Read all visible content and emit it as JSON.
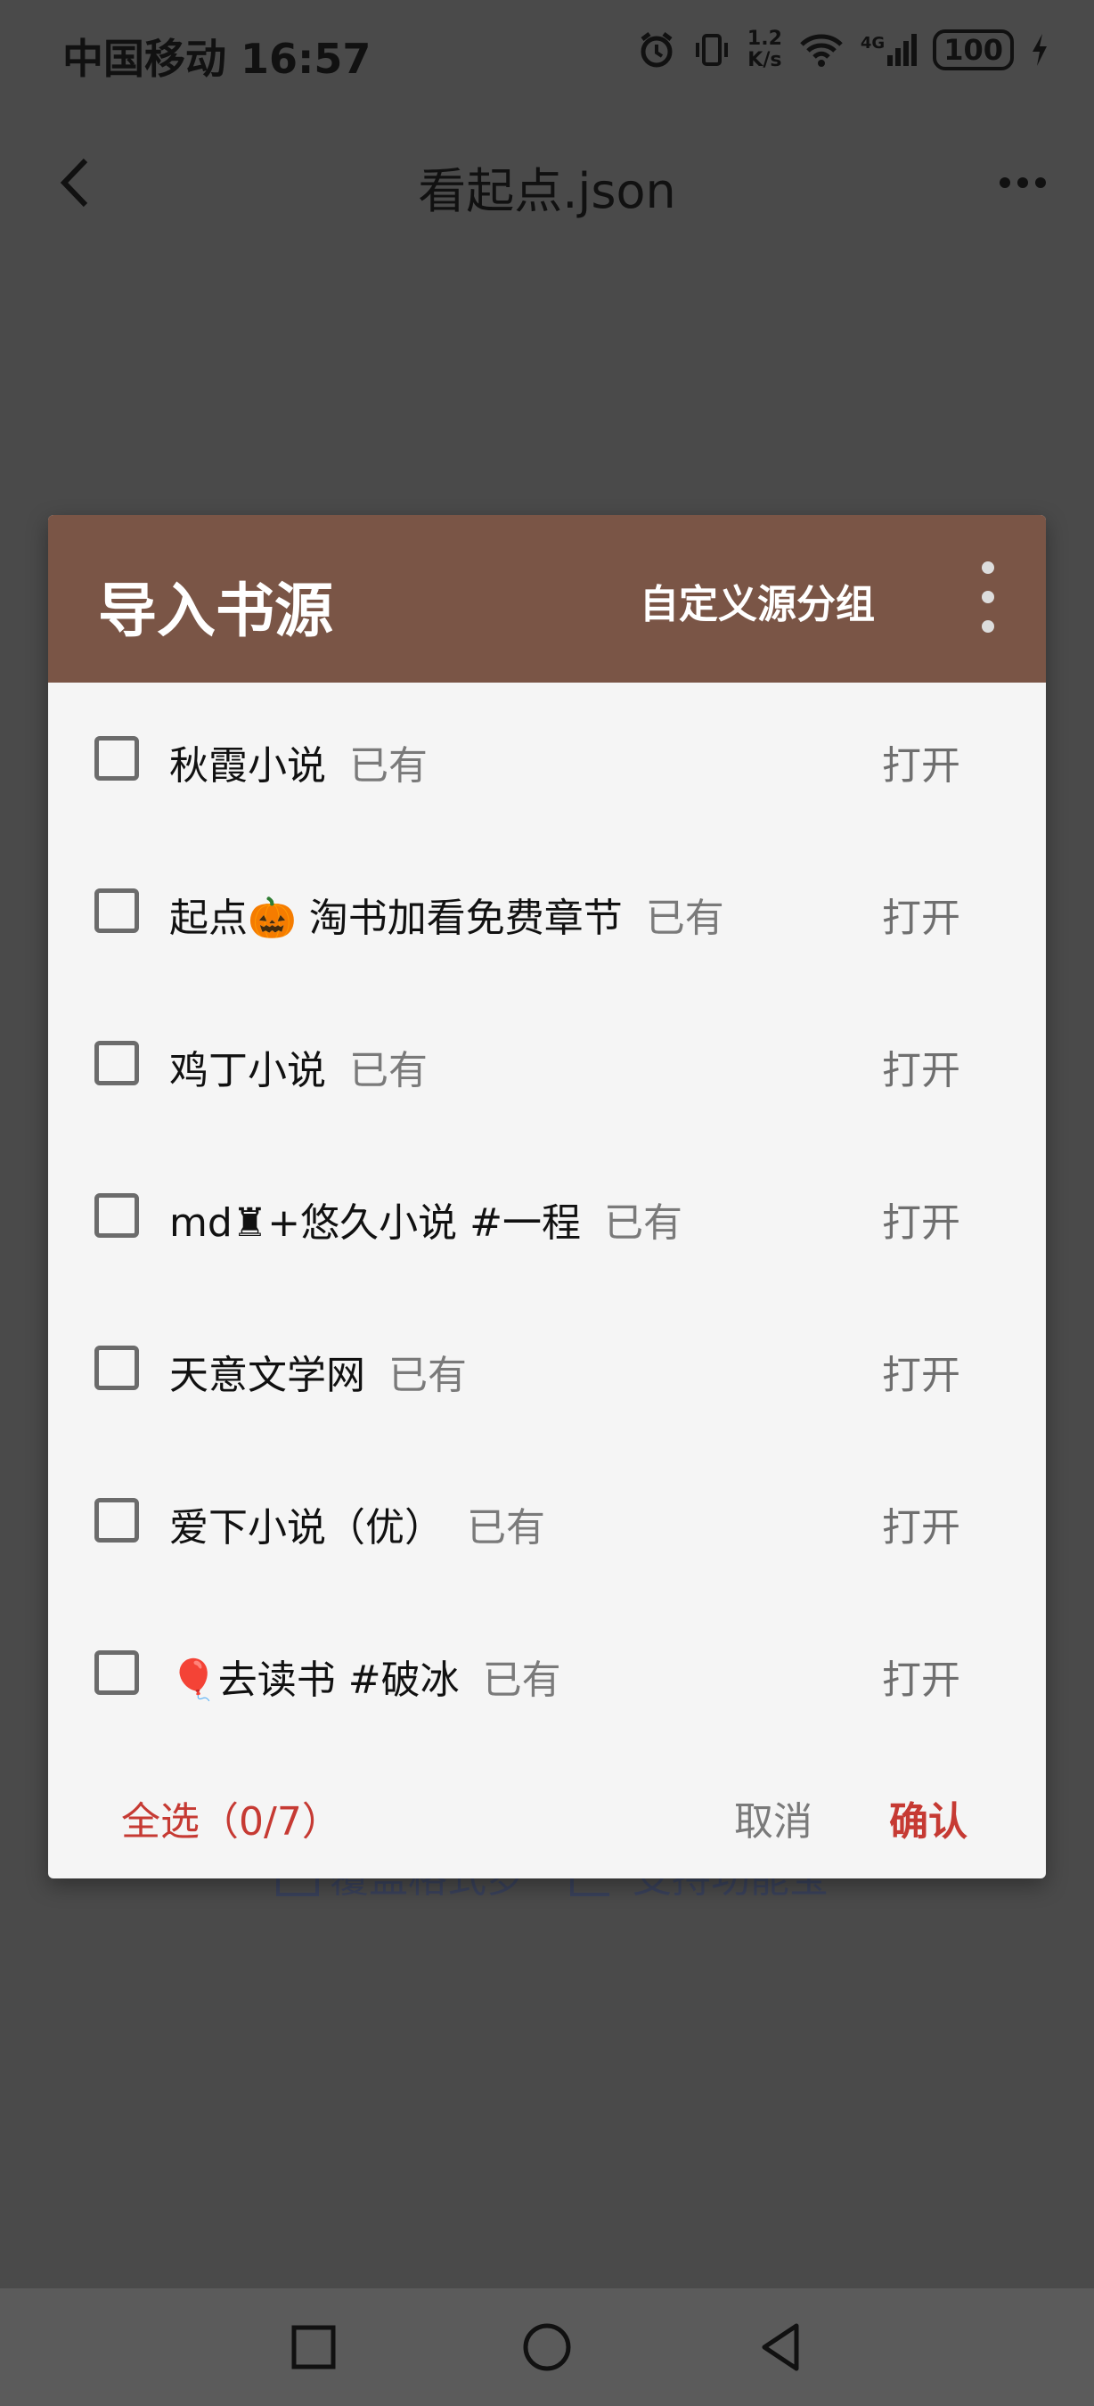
{
  "status_bar": {
    "carrier_time": "中国移动 16:57",
    "speed_top": "1.2",
    "speed_bottom": "K/s",
    "network": "4G",
    "battery": "100"
  },
  "app_bar": {
    "title": "看起点.json"
  },
  "dialog": {
    "title": "导入书源",
    "group_button": "自定义源分组",
    "items": [
      {
        "name": "秋霞小说",
        "tag": "已有",
        "action": "打开"
      },
      {
        "name": "起点🎃 淘书加看免费章节",
        "tag": "已有",
        "action": "打开"
      },
      {
        "name": "鸡丁小说",
        "tag": "已有",
        "action": "打开"
      },
      {
        "name": "md♜+悠久小说 #一程",
        "tag": "已有",
        "action": "打开"
      },
      {
        "name": "天意文学网",
        "tag": "已有",
        "action": "打开"
      },
      {
        "name": "爱下小说（优）",
        "tag": "已有",
        "action": "打开"
      },
      {
        "name": "🎈去读书 #破冰",
        "tag": "已有",
        "action": "打开"
      }
    ],
    "select_all": "全选（0/7）",
    "cancel": "取消",
    "confirm": "确认"
  },
  "background_hint": {
    "left": "覆盖格式罗",
    "right": "支持功能宝"
  },
  "colors": {
    "header": "#7a5546",
    "accent": "#c63a33",
    "dialog_bg": "#f5f5f5"
  }
}
